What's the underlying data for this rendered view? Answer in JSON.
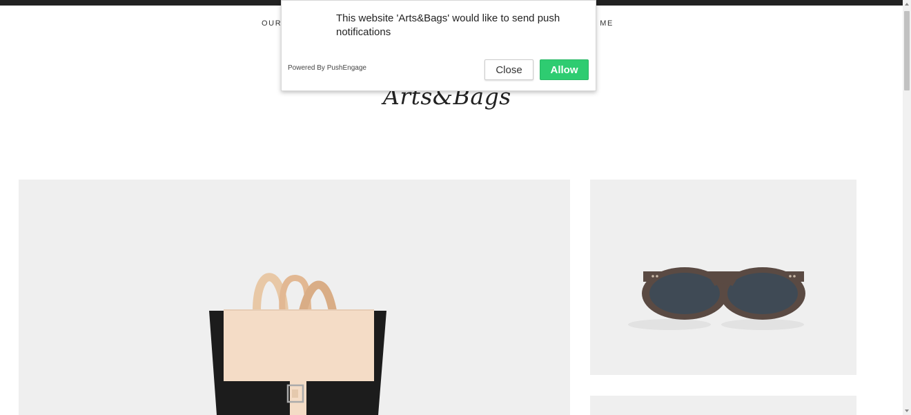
{
  "nav": {
    "left_partial": "OUR",
    "right_partial": "D ME"
  },
  "logo": "Arts&Bags",
  "popup": {
    "message": "This website 'Arts&Bags' would like to send push notifications",
    "powered_by": "Powered By PushEngage",
    "close_label": "Close",
    "allow_label": "Allow",
    "allow_color": "#2ecc71"
  },
  "products": [
    {
      "name": "backpack-image",
      "icon": "backpack"
    },
    {
      "name": "sunglasses-image",
      "icon": "sunglasses"
    }
  ]
}
